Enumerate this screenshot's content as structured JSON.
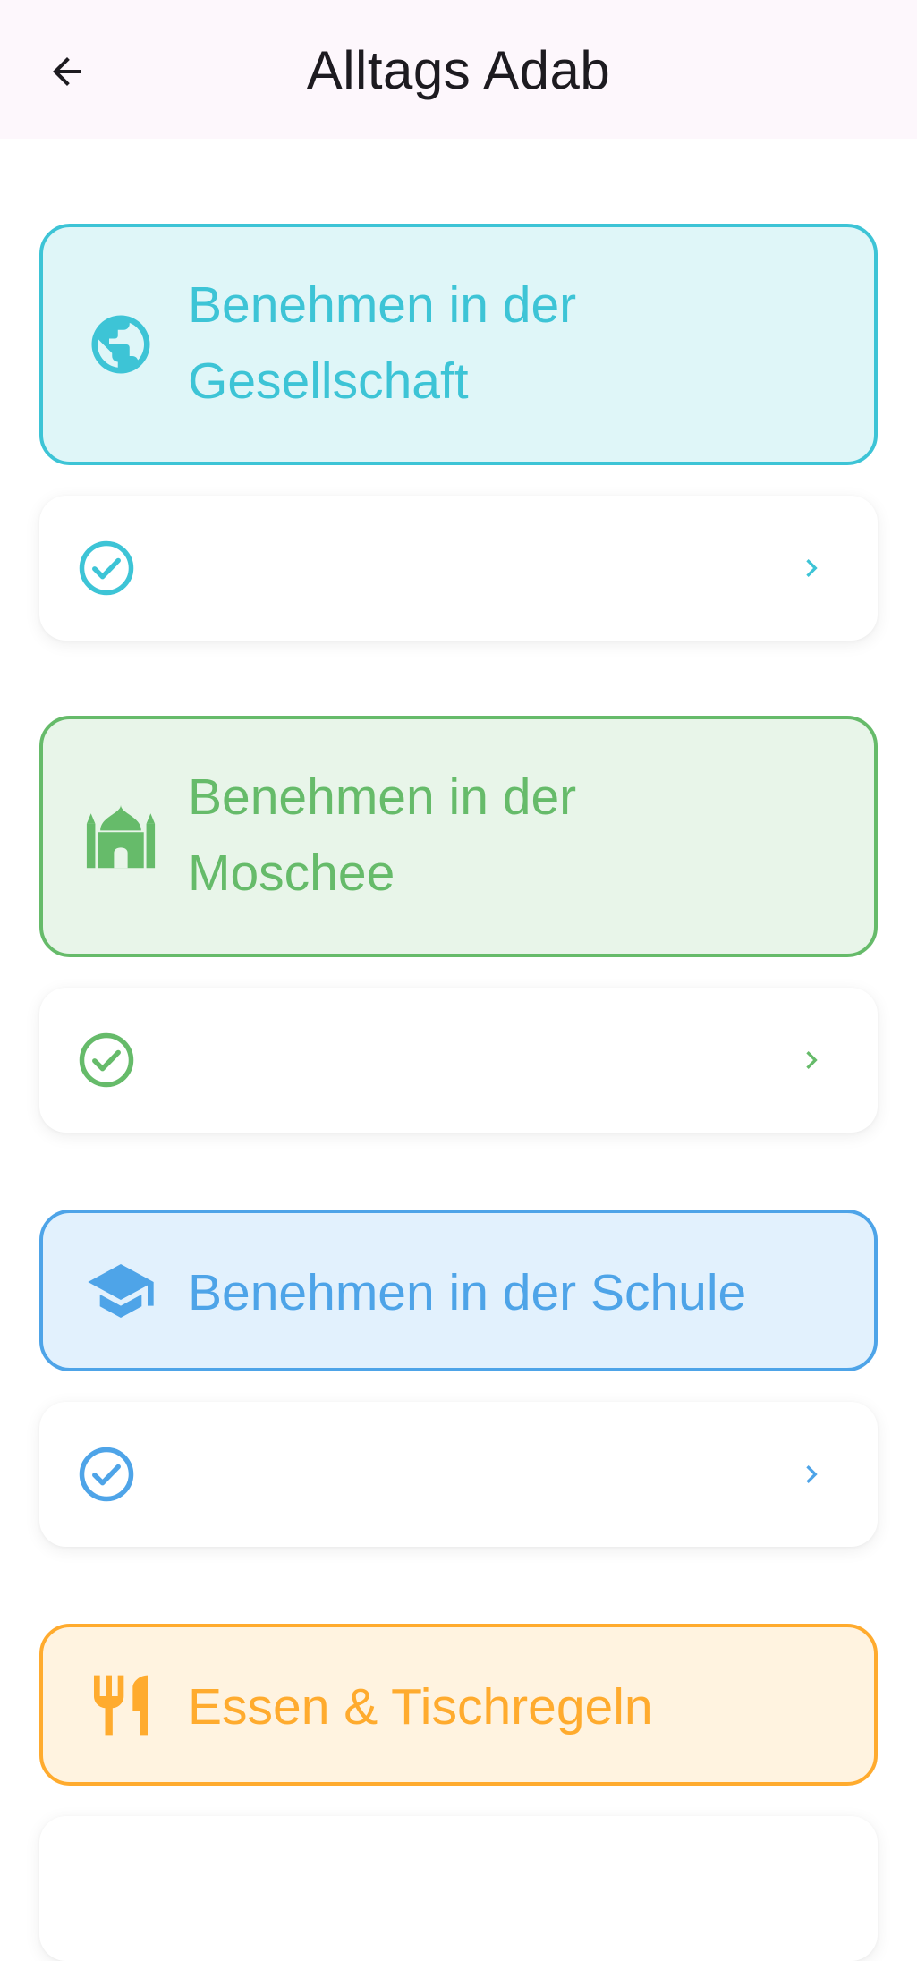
{
  "appbar": {
    "title": "Alltags Adab",
    "back_icon": "arrow-left-icon"
  },
  "sections": [
    {
      "label_line1": "Benehmen in der",
      "label_line2": "Gesellschaft",
      "icon": "globe-icon",
      "accent": "#3dc4d6",
      "bg": "#dff6f8",
      "item": {
        "label": "",
        "icon": "check-circle-icon",
        "chevron": "chevron-right-icon"
      }
    },
    {
      "label_line1": "Benehmen in der",
      "label_line2": "Moschee",
      "icon": "mosque-icon",
      "accent": "#66bb6a",
      "bg": "#e8f5e9",
      "item": {
        "label": "",
        "icon": "check-circle-icon",
        "chevron": "chevron-right-icon"
      }
    },
    {
      "label_line1": "Benehmen in der Schule",
      "icon": "graduation-cap-icon",
      "accent": "#4ea4e8",
      "bg": "#e2f1fd",
      "item": {
        "label": "",
        "icon": "check-circle-icon",
        "chevron": "chevron-right-icon"
      }
    },
    {
      "label_line1": "Essen & Tischregeln",
      "icon": "restaurant-icon",
      "accent": "#ffab2e",
      "bg": "#fff3e0"
    }
  ]
}
